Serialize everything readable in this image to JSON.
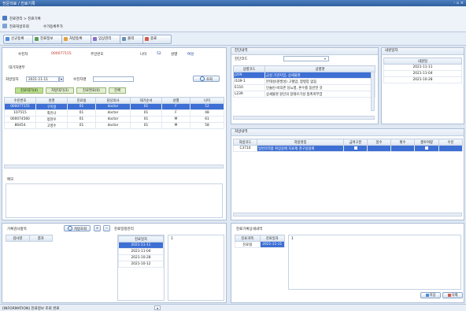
{
  "window": {
    "title": "전문의료 / 진료기록",
    "controls": "- ▫ ×"
  },
  "menu": {
    "line1": "진료관리 > 진료기록",
    "line2": "진료처방조회",
    "line2b": "수가등록추가"
  },
  "toolbar": {
    "buttons": [
      "신규등록",
      "진료정보",
      "처방등록",
      "임상관리",
      "출력",
      "종료"
    ]
  },
  "patient": {
    "header": {
      "label_name": "수진자",
      "name": "000077155",
      "label_birth": "주민번호",
      "age_label": "나이",
      "age": "52",
      "gender_label": "성별",
      "gender_value": "여성"
    },
    "search": {
      "section_label": "대기자명부",
      "date_label": "처방일자",
      "date_value": "2021-11-11",
      "name_label": "수진자명",
      "search_button": "조회"
    },
    "tabs": [
      "진료대기(4)",
      "처방대기(3)",
      "진료완료(0)",
      "전체"
    ],
    "columns": [
      "수진번호",
      "성명",
      "진료실",
      "담당의사",
      "대기순서",
      "성별",
      "나이"
    ],
    "rows": [
      [
        "000077155",
        "구미정",
        "01",
        "doctor",
        "01",
        "F",
        "52"
      ],
      [
        "107515",
        "최유나",
        "01",
        "doctor",
        "01",
        "F",
        "48"
      ],
      [
        "000074560",
        "정현우",
        "01",
        "doctor",
        "01",
        "M",
        "61"
      ],
      [
        "86454",
        "고영수",
        "01",
        "doctor",
        "01",
        "M",
        "58"
      ]
    ],
    "memo_label": "메모"
  },
  "diagnosis": {
    "title": "진단내역",
    "code_label": "진단코드",
    "columns": [
      "상병코드",
      "상병명"
    ],
    "rows": [
      [
        "J209",
        "급성 기관지염, 상세불명"
      ],
      [
        "I109-1",
        "본태성(원발성) 고혈압, 합병증 없음"
      ],
      [
        "E110",
        "인슐린-비의존 당뇨병, 혼수를 동반한 것"
      ],
      [
        "L239",
        "상세불명 원인의 알레르기성 접촉피부염"
      ]
    ]
  },
  "visits": {
    "title": "내원일자",
    "column": "내원일",
    "dates": [
      "2021-11-11",
      "2021-11-04",
      "2021-10-28"
    ]
  },
  "orders": {
    "title": "처방내역",
    "columns": [
      "처방코드",
      "처방명칭",
      "급여구분",
      "일수",
      "횟수",
      "총투여량",
      "수진"
    ],
    "rows": [
      [
        "C3710",
        "일반의약품 위장장애 치료제 경구용정제",
        "",
        "",
        "",
        "",
        ""
      ]
    ]
  },
  "bottom_left": {
    "title": "기록검사항목",
    "columns": [
      "검사명",
      "결과"
    ],
    "lookup_button": "처방조회",
    "add_button": "+",
    "remove_button": "−",
    "history_title": "진료일정관리",
    "history_column": "진료일자",
    "history_dates": [
      "2021-11-11",
      "2021-11-04",
      "2021-10-28",
      "2021-10-12"
    ],
    "note_value": "1"
  },
  "bottom_right": {
    "title": "진료기록상세내역",
    "columns": [
      "진료과목",
      "진료일자"
    ],
    "row": [
      "진료실",
      "2021-11-11"
    ],
    "note_value": "1",
    "save_button": "저장",
    "delete_button": "삭제"
  },
  "status": {
    "text": "[INFORMATION] 진료정보 조회 완료"
  }
}
